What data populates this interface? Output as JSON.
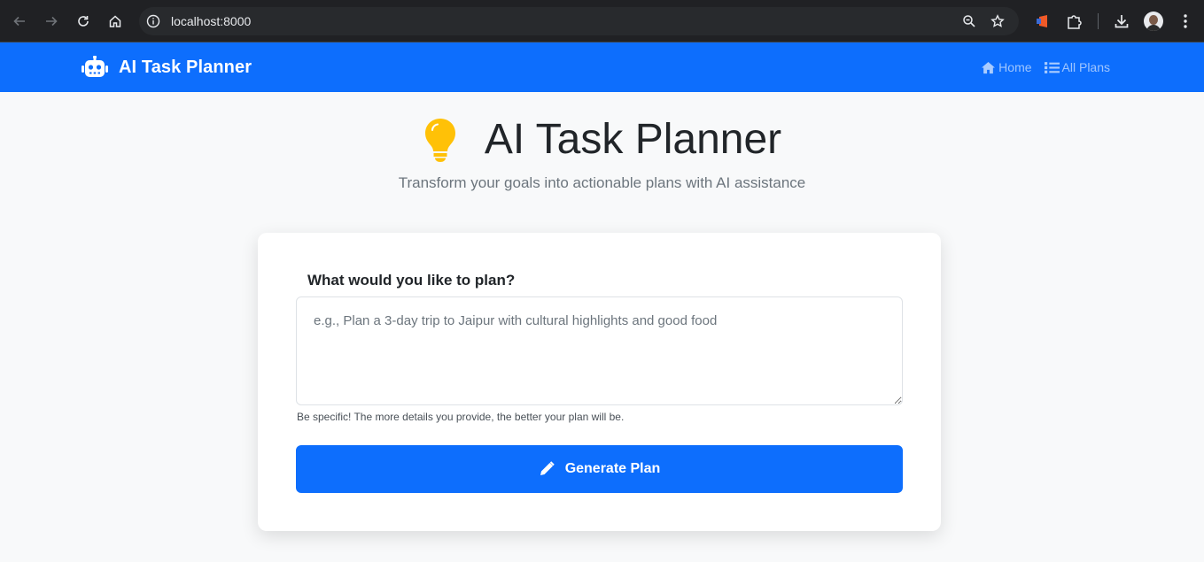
{
  "browser": {
    "url": "localhost:8000",
    "icons": [
      "back-icon",
      "forward-icon",
      "reload-icon",
      "home-icon",
      "site-info-icon",
      "zoom-icon",
      "bookmark-star-icon",
      "extension-icon",
      "puzzle-icon",
      "download-icon",
      "profile-avatar",
      "menu-kebab-icon"
    ]
  },
  "navbar": {
    "brand": "AI Task Planner",
    "brand_icon": "robot-icon",
    "links": [
      {
        "label": "Home",
        "icon": "home-icon"
      },
      {
        "label": "All Plans",
        "icon": "list-icon"
      }
    ],
    "color": "#0d6efd"
  },
  "hero": {
    "title": "AI Task Planner",
    "icon": "lightbulb-icon",
    "icon_color": "#ffc107",
    "subtitle": "Transform your goals into actionable plans with AI assistance"
  },
  "form": {
    "label": "What would you like to plan?",
    "placeholder": "e.g., Plan a 3-day trip to Jaipur with cultural highlights and good food",
    "value": "",
    "help": "Be specific! The more details you provide, the better your plan will be.",
    "submit_label": "Generate Plan",
    "submit_icon": "pencil-icon"
  }
}
